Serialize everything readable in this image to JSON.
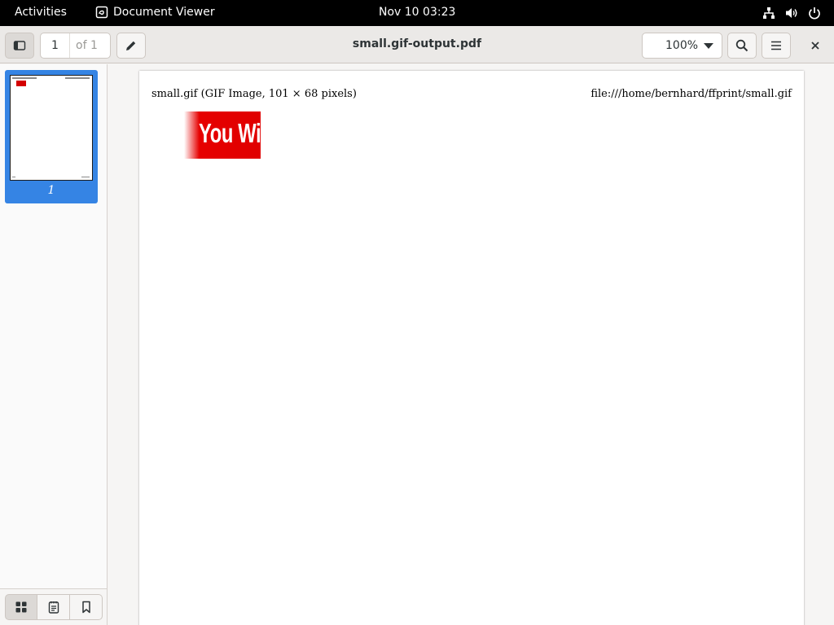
{
  "topbar": {
    "activities": "Activities",
    "app_name": "Document Viewer",
    "clock": "Nov 10  03:23",
    "tray_icons": [
      "network-icon",
      "volume-icon",
      "power-icon"
    ]
  },
  "headerbar": {
    "title": "small.gif-output.pdf",
    "current_page": "1",
    "page_total": "of 1",
    "zoom": "100%"
  },
  "sidebar": {
    "thumbnails": [
      {
        "label": "1",
        "selected": true
      }
    ],
    "footer_buttons": [
      "thumbnails-icon",
      "annotations-icon",
      "bookmarks-icon"
    ]
  },
  "document": {
    "header_left": "small.gif (GIF Image, 101 × 68 pixels)",
    "header_right": "file:///home/bernhard/ffprint/small.gif",
    "image_text": "You Will"
  },
  "colors": {
    "accent": "#3584e4",
    "image_red": "#e00000",
    "topbar": "#000000"
  }
}
